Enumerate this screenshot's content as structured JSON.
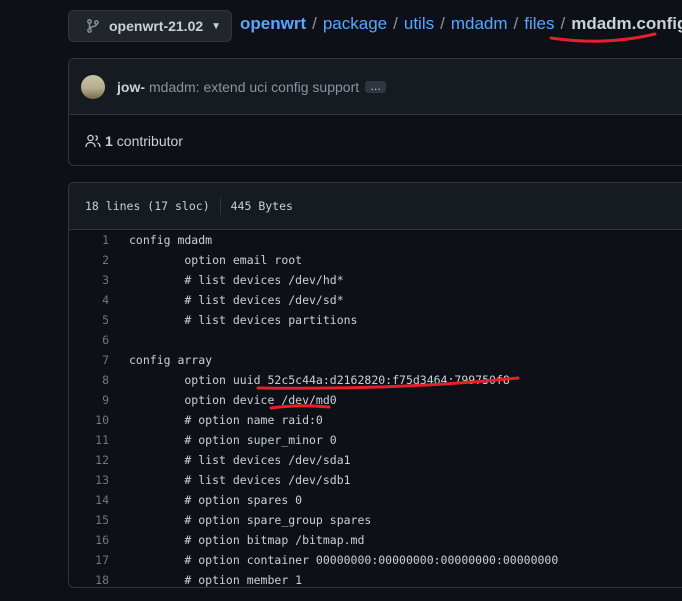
{
  "branch": {
    "name": "openwrt-21.02",
    "icon": "git-branch-icon"
  },
  "breadcrumb": {
    "root": "openwrt",
    "items": [
      "package",
      "utils",
      "mdadm",
      "files"
    ],
    "current": "mdadm.config"
  },
  "commit": {
    "author": "jow-",
    "message": "mdadm: extend uci config support",
    "ellipsis": "…"
  },
  "contributors": {
    "count": "1",
    "label": "contributor"
  },
  "file": {
    "lines": "18 lines (17 sloc)",
    "size": "445 Bytes"
  },
  "code": [
    {
      "n": "1",
      "t": "config mdadm"
    },
    {
      "n": "2",
      "t": "        option email root"
    },
    {
      "n": "3",
      "t": "        # list devices /dev/hd*"
    },
    {
      "n": "4",
      "t": "        # list devices /dev/sd*"
    },
    {
      "n": "5",
      "t": "        # list devices partitions"
    },
    {
      "n": "6",
      "t": ""
    },
    {
      "n": "7",
      "t": "config array"
    },
    {
      "n": "8",
      "t": "        option uuid 52c5c44a:d2162820:f75d3464:799750f8"
    },
    {
      "n": "9",
      "t": "        option device /dev/md0"
    },
    {
      "n": "10",
      "t": "        # option name raid:0"
    },
    {
      "n": "11",
      "t": "        # option super_minor 0"
    },
    {
      "n": "12",
      "t": "        # list devices /dev/sda1"
    },
    {
      "n": "13",
      "t": "        # list devices /dev/sdb1"
    },
    {
      "n": "14",
      "t": "        # option spares 0"
    },
    {
      "n": "15",
      "t": "        # option spare_group spares"
    },
    {
      "n": "16",
      "t": "        # option bitmap /bitmap.md"
    },
    {
      "n": "17",
      "t": "        # option container 00000000:00000000:00000000:00000000"
    },
    {
      "n": "18",
      "t": "        # option member 1"
    }
  ],
  "colors": {
    "background": "#0d1117",
    "link": "#58a6ff",
    "annotation": "#e5202a"
  }
}
